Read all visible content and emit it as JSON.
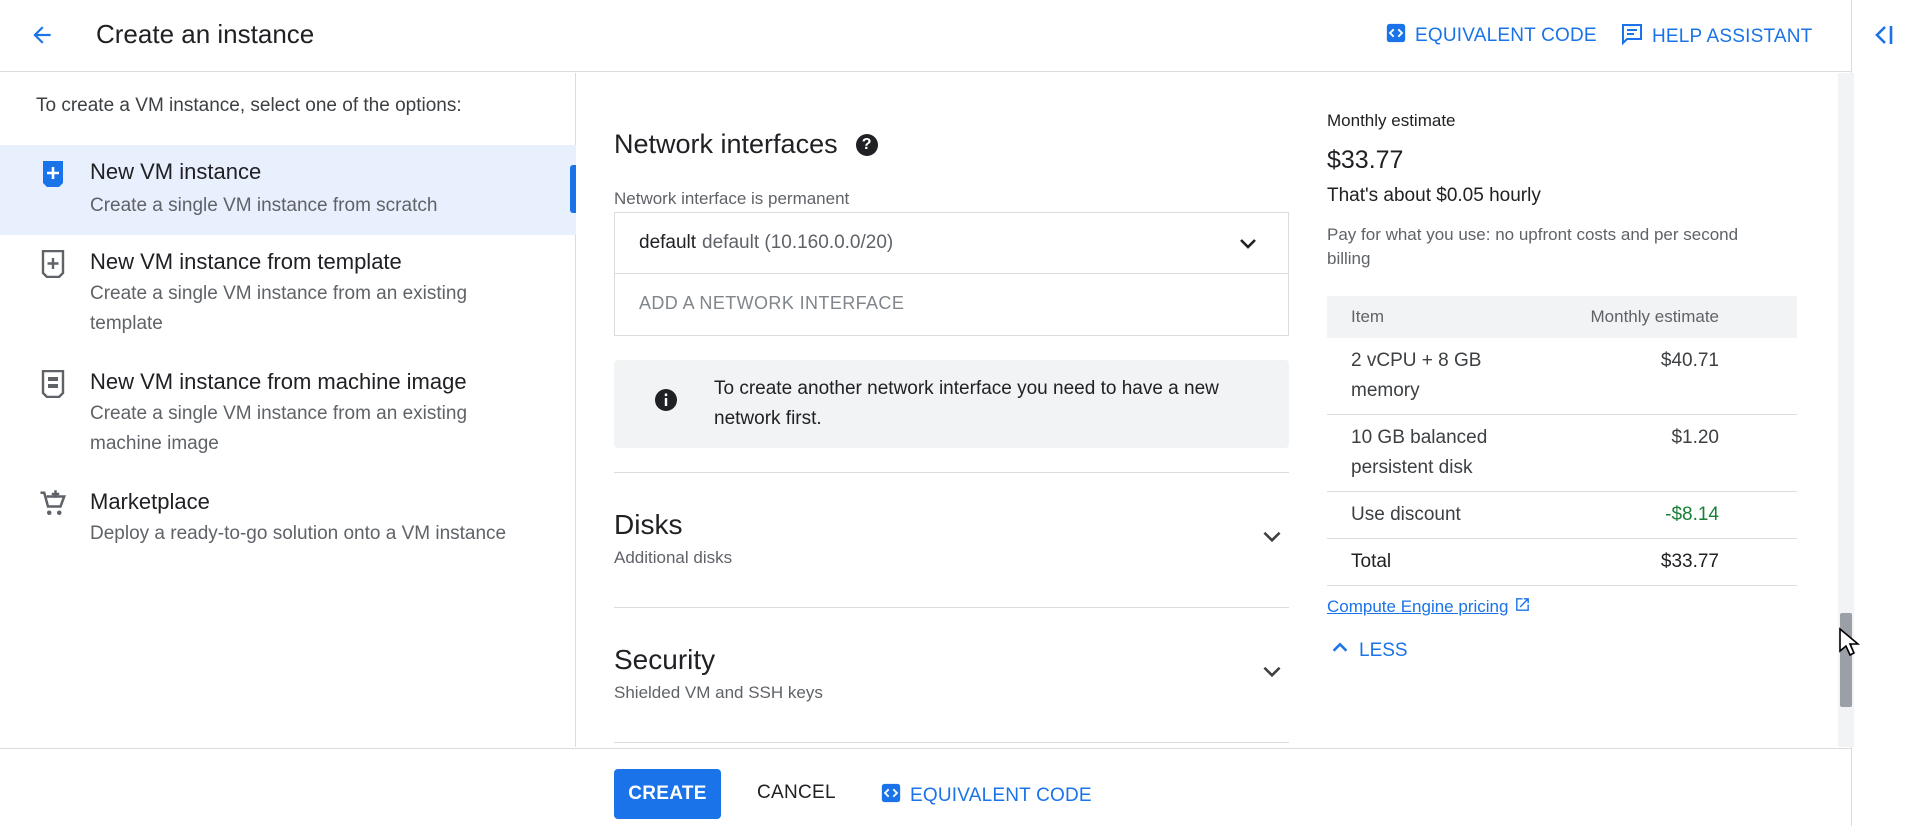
{
  "header": {
    "title": "Create an instance",
    "equivalent_code_label": "EQUIVALENT CODE",
    "help_assistant_label": "HELP ASSISTANT"
  },
  "sidebar": {
    "intro": "To create a VM instance, select one of the options:",
    "options": [
      {
        "title": "New VM instance",
        "description": "Create a single VM instance from scratch",
        "icon": "add-box-icon",
        "selected": true
      },
      {
        "title": "New VM instance from template",
        "description": "Create a single VM instance from an existing template",
        "icon": "template-icon",
        "selected": false
      },
      {
        "title": "New VM instance from machine image",
        "description": "Create a single VM instance from an existing machine image",
        "icon": "machine-image-icon",
        "selected": false
      },
      {
        "title": "Marketplace",
        "description": "Deploy a ready-to-go solution onto a VM instance",
        "icon": "cart-icon",
        "selected": false
      }
    ]
  },
  "network": {
    "title": "Network interfaces",
    "permanent_label": "Network interface is permanent",
    "interface_name": "default",
    "interface_detail": "default (10.160.0.0/20)",
    "add_label": "ADD A NETWORK INTERFACE",
    "info_text": "To create another network interface you need to have a new network first."
  },
  "sections": {
    "disks": {
      "title": "Disks",
      "subtitle": "Additional disks"
    },
    "security": {
      "title": "Security",
      "subtitle": "Shielded VM and SSH keys"
    }
  },
  "estimate": {
    "label": "Monthly estimate",
    "amount": "$33.77",
    "hourly": "That's about $0.05 hourly",
    "note": "Pay for what you use: no upfront costs and per second billing",
    "col_item": "Item",
    "col_estimate": "Monthly estimate",
    "rows": [
      {
        "item": "2 vCPU + 8 GB memory",
        "value": "$40.71"
      },
      {
        "item": "10 GB balanced persistent disk",
        "value": "$1.20"
      },
      {
        "item": "Use discount",
        "value": "-$8.14"
      },
      {
        "item": "Total",
        "value": "$33.77"
      }
    ],
    "pricing_link": "Compute Engine pricing",
    "less_label": "LESS"
  },
  "footer": {
    "create_label": "CREATE",
    "cancel_label": "CANCEL",
    "equivalent_code_label": "EQUIVALENT CODE"
  },
  "colors": {
    "accent": "#1a73e8",
    "selected_bg": "#e8f0fe",
    "discount_green": "#188038"
  }
}
